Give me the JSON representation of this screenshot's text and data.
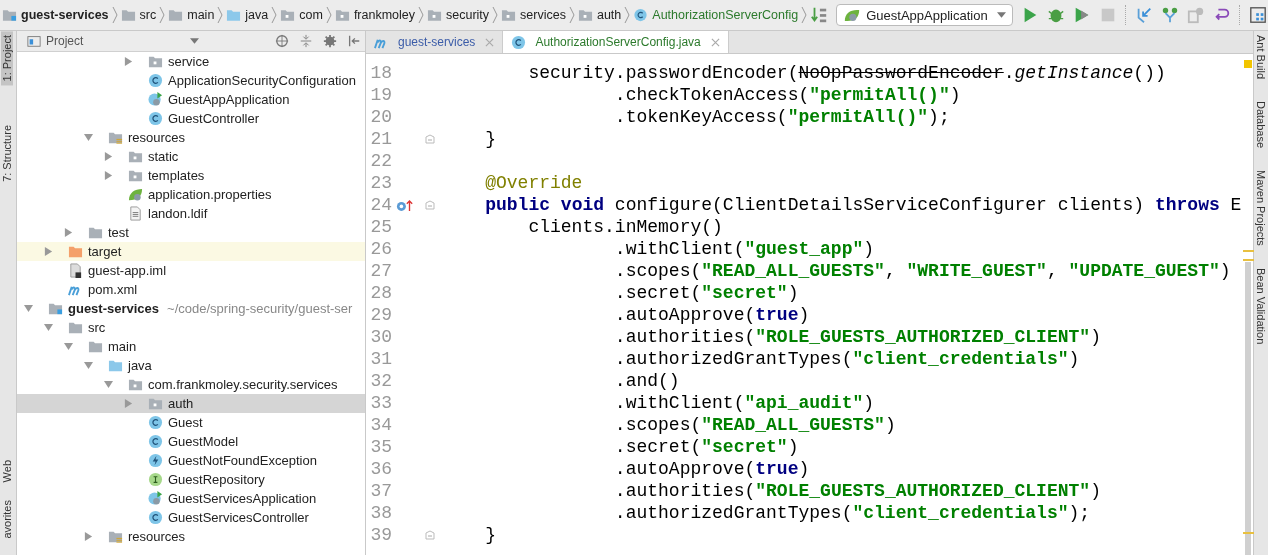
{
  "breadcrumbs": [
    {
      "label": "guest-services",
      "kind": "module"
    },
    {
      "label": "src",
      "kind": "folder"
    },
    {
      "label": "main",
      "kind": "folder"
    },
    {
      "label": "java",
      "kind": "source-folder"
    },
    {
      "label": "com",
      "kind": "package"
    },
    {
      "label": "frankmoley",
      "kind": "package"
    },
    {
      "label": "security",
      "kind": "package"
    },
    {
      "label": "services",
      "kind": "package"
    },
    {
      "label": "auth",
      "kind": "package"
    },
    {
      "label": "AuthorizationServerConfig",
      "kind": "class"
    }
  ],
  "run_configuration": {
    "label": "GuestAppApplication"
  },
  "left_tool_tabs": [
    {
      "label": "1: Project",
      "selected": true
    },
    {
      "label": "7: Structure",
      "selected": false
    },
    {
      "label": "Web",
      "selected": false
    },
    {
      "label": "avorites",
      "selected": false
    }
  ],
  "right_tool_tabs": [
    {
      "label": "Ant Build"
    },
    {
      "label": "Database"
    },
    {
      "label": "Maven Projects"
    },
    {
      "label": "Bean Validation"
    }
  ],
  "project_panel": {
    "title": "Project"
  },
  "tree": [
    {
      "children": [
        {
          "children": [
            {
              "children": [
                {
                  "children": [
                    {
                      "children": [
                        {
                          "label": "service",
                          "kind": "package",
                          "expanded": false,
                          "selected": false,
                          "highlighted": false
                        },
                        {
                          "label": "ApplicationSecurityConfiguration",
                          "kind": "class",
                          "selected": false,
                          "highlighted": false
                        },
                        {
                          "label": "GuestAppApplication",
                          "kind": "spring-class",
                          "selected": false,
                          "highlighted": false
                        },
                        {
                          "label": "GuestController",
                          "kind": "class",
                          "selected": false,
                          "highlighted": false
                        }
                      ]
                    }
                  ]
                },
                {
                  "label": "resources",
                  "kind": "resource-folder",
                  "expanded": true,
                  "selected": false,
                  "highlighted": false,
                  "children": [
                    {
                      "label": "static",
                      "kind": "package",
                      "expanded": false,
                      "selected": false,
                      "highlighted": false
                    },
                    {
                      "label": "templates",
                      "kind": "package",
                      "expanded": false,
                      "selected": false,
                      "highlighted": false
                    },
                    {
                      "label": "application.properties",
                      "kind": "properties",
                      "selected": false,
                      "highlighted": false
                    },
                    {
                      "label": "landon.ldif",
                      "kind": "file",
                      "selected": false,
                      "highlighted": false
                    }
                  ]
                }
              ]
            },
            {
              "label": "test",
              "kind": "folder",
              "expanded": false,
              "selected": false,
              "highlighted": false
            }
          ]
        },
        {
          "label": "target",
          "kind": "excluded-folder",
          "expanded": false,
          "selected": false,
          "highlighted": true
        },
        {
          "label": "guest-app.iml",
          "kind": "module-file",
          "selected": false,
          "highlighted": false
        },
        {
          "label": "pom.xml",
          "kind": "maven",
          "selected": false,
          "highlighted": false
        }
      ]
    },
    {
      "label": "guest-services",
      "path": "~/code/spring-security/guest-ser",
      "kind": "module",
      "expanded": true,
      "selected": false,
      "highlighted": false,
      "children": [
        {
          "label": "src",
          "kind": "folder",
          "expanded": true,
          "selected": false,
          "highlighted": false,
          "children": [
            {
              "label": "main",
              "kind": "folder",
              "expanded": true,
              "selected": false,
              "highlighted": false,
              "children": [
                {
                  "label": "java",
                  "kind": "source-folder",
                  "expanded": true,
                  "selected": false,
                  "highlighted": false,
                  "children": [
                    {
                      "label": "com.frankmoley.security.services",
                      "kind": "package",
                      "expanded": true,
                      "selected": false,
                      "highlighted": false,
                      "children": [
                        {
                          "label": "auth",
                          "kind": "package",
                          "expanded": false,
                          "selected": true,
                          "highlighted": false
                        },
                        {
                          "label": "Guest",
                          "kind": "class",
                          "selected": false,
                          "highlighted": false
                        },
                        {
                          "label": "GuestModel",
                          "kind": "class",
                          "selected": false,
                          "highlighted": false
                        },
                        {
                          "label": "GuestNotFoundException",
                          "kind": "exception",
                          "selected": false,
                          "highlighted": false
                        },
                        {
                          "label": "GuestRepository",
                          "kind": "interface",
                          "selected": false,
                          "highlighted": false
                        },
                        {
                          "label": "GuestServicesApplication",
                          "kind": "spring-class",
                          "selected": false,
                          "highlighted": false
                        },
                        {
                          "label": "GuestServicesController",
                          "kind": "class",
                          "selected": false,
                          "highlighted": false
                        }
                      ]
                    }
                  ]
                },
                {
                  "label": "resources",
                  "kind": "resource-folder",
                  "expanded": false,
                  "selected": false,
                  "highlighted": false
                }
              ]
            }
          ]
        }
      ]
    }
  ],
  "editor_tabs": [
    {
      "label": "guest-services",
      "kind": "maven",
      "selected": false
    },
    {
      "label": "AuthorizationServerConfig.java",
      "kind": "class",
      "selected": true
    }
  ],
  "code_lines": [
    {
      "number": "18",
      "fold": false,
      "tokens": [
        {
          "text": "        security.passwordEncoder(",
          "kind": "plain"
        },
        {
          "text": "NoOpPasswordEncoder",
          "kind": "strike"
        },
        {
          "text": ".",
          "kind": "plain"
        },
        {
          "text": "getInstance",
          "kind": "italic"
        },
        {
          "text": "())",
          "kind": "plain"
        }
      ]
    },
    {
      "number": "19",
      "fold": false,
      "tokens": [
        {
          "text": "                .checkTokenAccess(",
          "kind": "plain"
        },
        {
          "text": "\"permitAll()\"",
          "kind": "string"
        },
        {
          "text": ")",
          "kind": "plain"
        }
      ]
    },
    {
      "number": "20",
      "fold": false,
      "tokens": [
        {
          "text": "                .tokenKeyAccess(",
          "kind": "plain"
        },
        {
          "text": "\"permitAll()\"",
          "kind": "string"
        },
        {
          "text": ");",
          "kind": "plain"
        }
      ]
    },
    {
      "number": "21",
      "fold": true,
      "tokens": [
        {
          "text": "    }",
          "kind": "plain"
        }
      ]
    },
    {
      "number": "22",
      "fold": false
    },
    {
      "number": "23",
      "fold": false,
      "tokens": [
        {
          "text": "    @Override",
          "kind": "annotation"
        }
      ]
    },
    {
      "number": "24",
      "fold": true,
      "override": true,
      "tokens": [
        {
          "text": "    public",
          "kind": "keyword"
        },
        {
          "text": " void",
          "kind": "keyword"
        },
        {
          "text": " configure(ClientDetailsServiceConfigurer clients) ",
          "kind": "plain"
        },
        {
          "text": "throws",
          "kind": "keyword"
        },
        {
          "text": " E",
          "kind": "plain"
        }
      ]
    },
    {
      "number": "25",
      "fold": false,
      "tokens": [
        {
          "text": "        clients.inMemory()",
          "kind": "plain"
        }
      ]
    },
    {
      "number": "26",
      "fold": false,
      "tokens": [
        {
          "text": "                .withClient(",
          "kind": "plain"
        },
        {
          "text": "\"guest_app\"",
          "kind": "string"
        },
        {
          "text": ")",
          "kind": "plain"
        }
      ]
    },
    {
      "number": "27",
      "fold": false,
      "tokens": [
        {
          "text": "                .scopes(",
          "kind": "plain"
        },
        {
          "text": "\"READ_ALL_GUESTS\"",
          "kind": "string"
        },
        {
          "text": ", ",
          "kind": "plain"
        },
        {
          "text": "\"WRITE_GUEST\"",
          "kind": "string"
        },
        {
          "text": ", ",
          "kind": "plain"
        },
        {
          "text": "\"UPDATE_GUEST\"",
          "kind": "string"
        },
        {
          "text": ")",
          "kind": "plain"
        }
      ]
    },
    {
      "number": "28",
      "fold": false,
      "tokens": [
        {
          "text": "                .secret(",
          "kind": "plain"
        },
        {
          "text": "\"secret\"",
          "kind": "string"
        },
        {
          "text": ")",
          "kind": "plain"
        }
      ]
    },
    {
      "number": "29",
      "fold": false,
      "tokens": [
        {
          "text": "                .autoApprove(",
          "kind": "plain"
        },
        {
          "text": "true",
          "kind": "keyword"
        },
        {
          "text": ")",
          "kind": "plain"
        }
      ]
    },
    {
      "number": "30",
      "fold": false,
      "tokens": [
        {
          "text": "                .authorities(",
          "kind": "plain"
        },
        {
          "text": "\"ROLE_GUESTS_AUTHORIZED_CLIENT\"",
          "kind": "string"
        },
        {
          "text": ")",
          "kind": "plain"
        }
      ]
    },
    {
      "number": "31",
      "fold": false,
      "tokens": [
        {
          "text": "                .authorizedGrantTypes(",
          "kind": "plain"
        },
        {
          "text": "\"client_credentials\"",
          "kind": "string"
        },
        {
          "text": ")",
          "kind": "plain"
        }
      ]
    },
    {
      "number": "32",
      "fold": false,
      "tokens": [
        {
          "text": "                .and()",
          "kind": "plain"
        }
      ]
    },
    {
      "number": "33",
      "fold": false,
      "tokens": [
        {
          "text": "                .withClient(",
          "kind": "plain"
        },
        {
          "text": "\"api_audit\"",
          "kind": "string"
        },
        {
          "text": ")",
          "kind": "plain"
        }
      ]
    },
    {
      "number": "34",
      "fold": false,
      "tokens": [
        {
          "text": "                .scopes(",
          "kind": "plain"
        },
        {
          "text": "\"READ_ALL_GUESTS\"",
          "kind": "string"
        },
        {
          "text": ")",
          "kind": "plain"
        }
      ]
    },
    {
      "number": "35",
      "fold": false,
      "tokens": [
        {
          "text": "                .secret(",
          "kind": "plain"
        },
        {
          "text": "\"secret\"",
          "kind": "string"
        },
        {
          "text": ")",
          "kind": "plain"
        }
      ]
    },
    {
      "number": "36",
      "fold": false,
      "tokens": [
        {
          "text": "                .autoApprove(",
          "kind": "plain"
        },
        {
          "text": "true",
          "kind": "keyword"
        },
        {
          "text": ")",
          "kind": "plain"
        }
      ]
    },
    {
      "number": "37",
      "fold": false,
      "tokens": [
        {
          "text": "                .authorities(",
          "kind": "plain"
        },
        {
          "text": "\"ROLE_GUESTS_AUTHORIZED_CLIENT\"",
          "kind": "string"
        },
        {
          "text": ")",
          "kind": "plain"
        }
      ]
    },
    {
      "number": "38",
      "fold": false,
      "tokens": [
        {
          "text": "                .authorizedGrantTypes(",
          "kind": "plain"
        },
        {
          "text": "\"client_credentials\"",
          "kind": "string"
        },
        {
          "text": ");",
          "kind": "plain"
        }
      ]
    },
    {
      "number": "39",
      "fold": true,
      "tokens": [
        {
          "text": "    }",
          "kind": "plain"
        }
      ]
    }
  ]
}
